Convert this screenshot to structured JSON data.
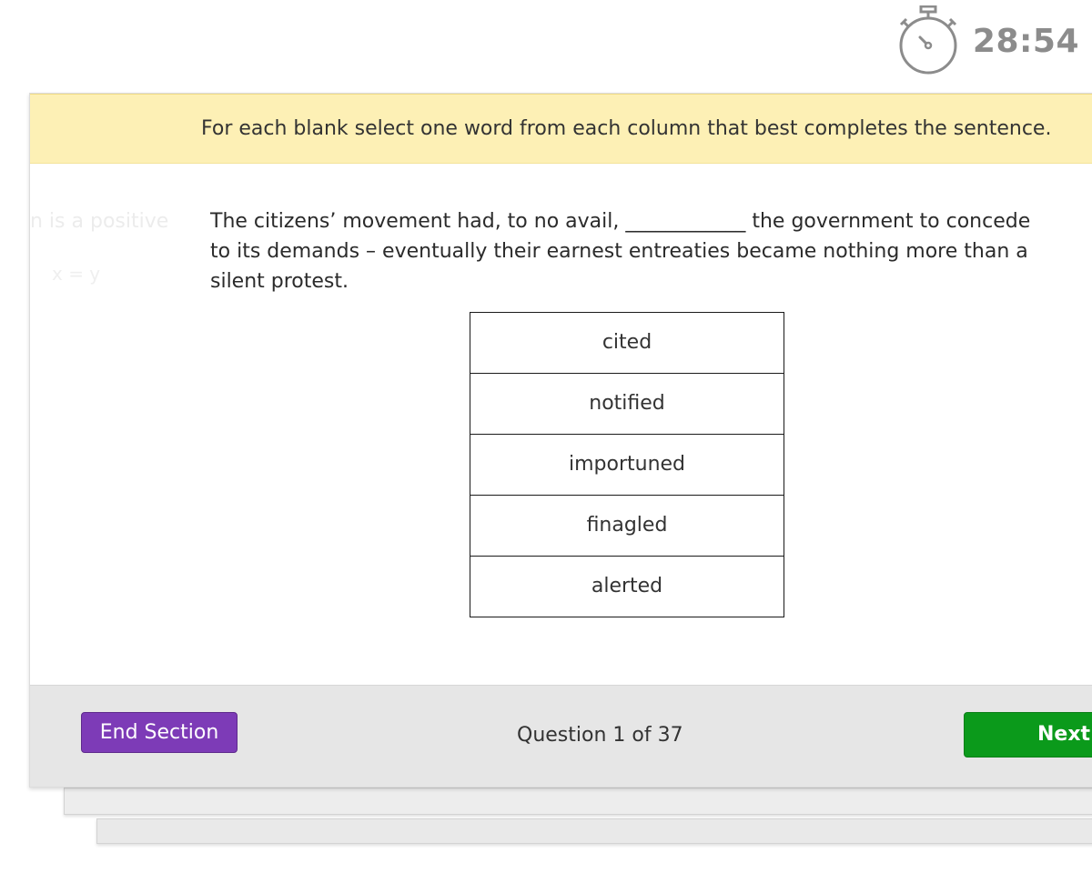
{
  "timer": {
    "icon": "stopwatch-icon",
    "remaining": "28:54"
  },
  "instruction": {
    "text": "For each blank select one word from each column that best completes the sentence."
  },
  "background_question": {
    "text": "n is a positive",
    "expression": "x = y"
  },
  "question": {
    "sentence": "The citizens’ movement had, to no avail, ____________ the government to concede to its demands – eventually their earnest entreaties became nothing more than a silent protest."
  },
  "choices": [
    {
      "label": "cited"
    },
    {
      "label": "notified"
    },
    {
      "label": "importuned"
    },
    {
      "label": "finagled"
    },
    {
      "label": "alerted"
    }
  ],
  "footer": {
    "end_section_label": "End Section",
    "question_counter": "Question 1 of 37",
    "next_label": "Next"
  },
  "colors": {
    "instruction_bg": "#fdf0b5",
    "end_section_bg": "#7d3bb7",
    "next_bg": "#0b9a1b",
    "timer_text": "#8c8c8c",
    "footer_bg": "#e6e6e6"
  }
}
